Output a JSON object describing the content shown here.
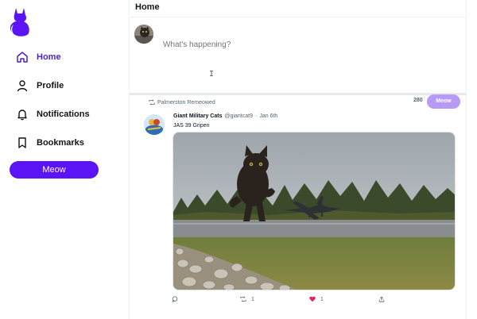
{
  "sidebar": {
    "logo_icon": "cat-logo-icon",
    "items": [
      {
        "label": "Home",
        "icon": "home-icon",
        "active": true
      },
      {
        "label": "Profile",
        "icon": "profile-icon"
      },
      {
        "label": "Notifications",
        "icon": "bell-icon"
      },
      {
        "label": "Bookmarks",
        "icon": "bookmark-icon"
      }
    ],
    "meow_button": "Meow"
  },
  "header": {
    "title": "Home"
  },
  "compose": {
    "placeholder": "What's happening?",
    "counter": "280",
    "meow_button": "Meow"
  },
  "post": {
    "remeow_text": "Palmerston Remeowed",
    "author_name": "Giant Military Cats",
    "author_handle": "@giantcat9",
    "separator": "·",
    "date": "Jan 6th",
    "text": "JAS 39 Gripen",
    "actions": {
      "reply_count": "",
      "remeow_count": "1",
      "like_count": "1"
    }
  },
  "colors": {
    "accent": "#5a14f5",
    "accent_text": "#4a1fd6",
    "meow_disabled": "#b69af6",
    "like": "#e0245e"
  }
}
